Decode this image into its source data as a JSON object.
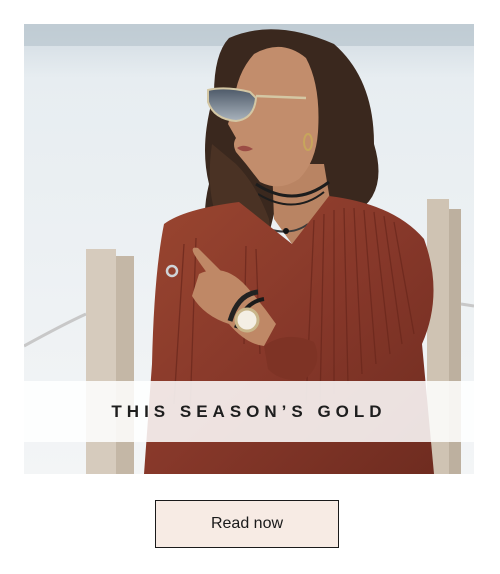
{
  "card": {
    "banner_title": "THIS SEASON’S GOLD",
    "image_alt": "Woman in rust pleated blouse and aviator sunglasses by the waterfront"
  },
  "cta": {
    "label": "Read now"
  },
  "colors": {
    "button_bg": "#f7ebe4",
    "button_border": "#1a1a1a",
    "banner_bg": "rgba(255,255,255,0.86)",
    "title_text": "#1e1e1e",
    "blouse": "#8a3a28"
  }
}
